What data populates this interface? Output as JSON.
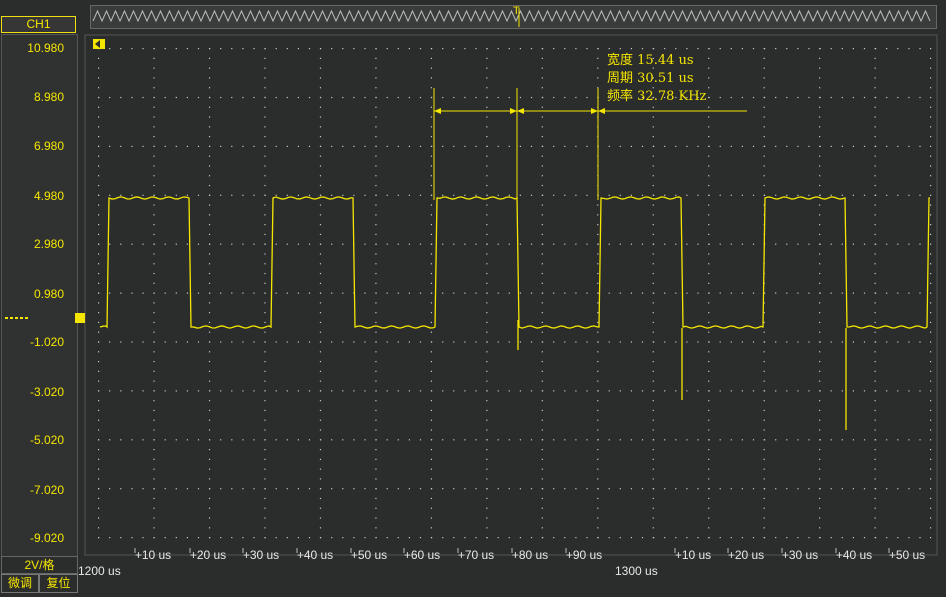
{
  "channel": {
    "label": "CH1",
    "color": "#f5e600"
  },
  "y_axis": {
    "ticks": [
      "10.980",
      "8.980",
      "6.980",
      "4.980",
      "2.980",
      "0.980",
      "-1.020",
      "-3.020",
      "-5.020",
      "-7.020",
      "-9.020"
    ]
  },
  "scale": {
    "label": "2V/格"
  },
  "buttons": {
    "fine_adjust": "微调",
    "reset": "复位"
  },
  "x_axis": {
    "ticks": [
      "+10 us",
      "+20 us",
      "+30 us",
      "+40 us",
      "+50 us",
      "+60 us",
      "+70 us",
      "+80 us",
      "+90 us",
      "+10 us",
      "+20 us",
      "+30 us",
      "+40 us",
      "+50 us"
    ],
    "left_marker": "1200 us",
    "center_marker": "1300 us"
  },
  "trigger": {
    "label": "T"
  },
  "measurements": [
    {
      "label": "宽度",
      "value": "15.44 us"
    },
    {
      "label": "周期",
      "value": "30.51 us"
    },
    {
      "label": "频率",
      "value": "32.78 KHz"
    }
  ],
  "colors": {
    "trace": "#f5e600",
    "grid_dot": "#c8c8c8",
    "screen_bg": "#2b2c2c",
    "panel_bg": "#303232"
  }
}
